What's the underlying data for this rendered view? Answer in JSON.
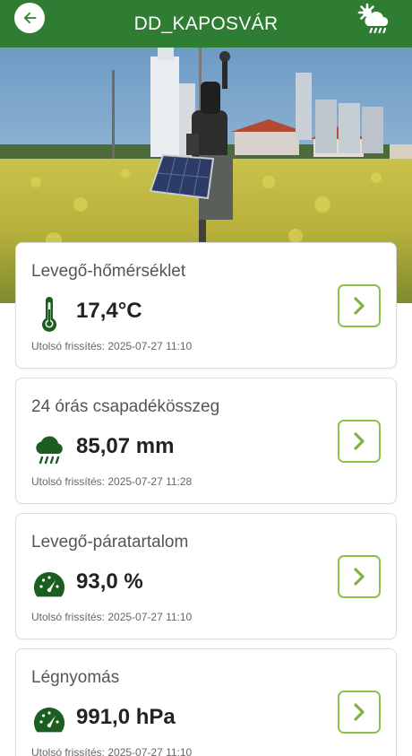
{
  "header": {
    "title": "DD_KAPOSVÁR",
    "back_icon": "arrow-left-icon",
    "weather_icon": "sun-cloud-rain-icon"
  },
  "colors": {
    "header_bg": "#2e7d32",
    "icon_green": "#1b5e20",
    "button_border": "#8bc34a"
  },
  "cards": [
    {
      "label": "Levegő-hőmérséklet",
      "value": "17,4°C",
      "updated": "Utolsó frissítés: 2025-07-27 11:10",
      "icon": "thermometer-icon"
    },
    {
      "label": "24 órás csapadékösszeg",
      "value": "85,07 mm",
      "updated": "Utolsó frissítés: 2025-07-27 11:28",
      "icon": "rain-cloud-icon"
    },
    {
      "label": "Levegő-páratartalom",
      "value": "93,0 %",
      "updated": "Utolsó frissítés: 2025-07-27 11:10",
      "icon": "gauge-icon"
    },
    {
      "label": "Légnyomás",
      "value": "991,0 hPa",
      "updated": "Utolsó frissítés: 2025-07-27 11:10",
      "icon": "gauge-icon"
    }
  ]
}
